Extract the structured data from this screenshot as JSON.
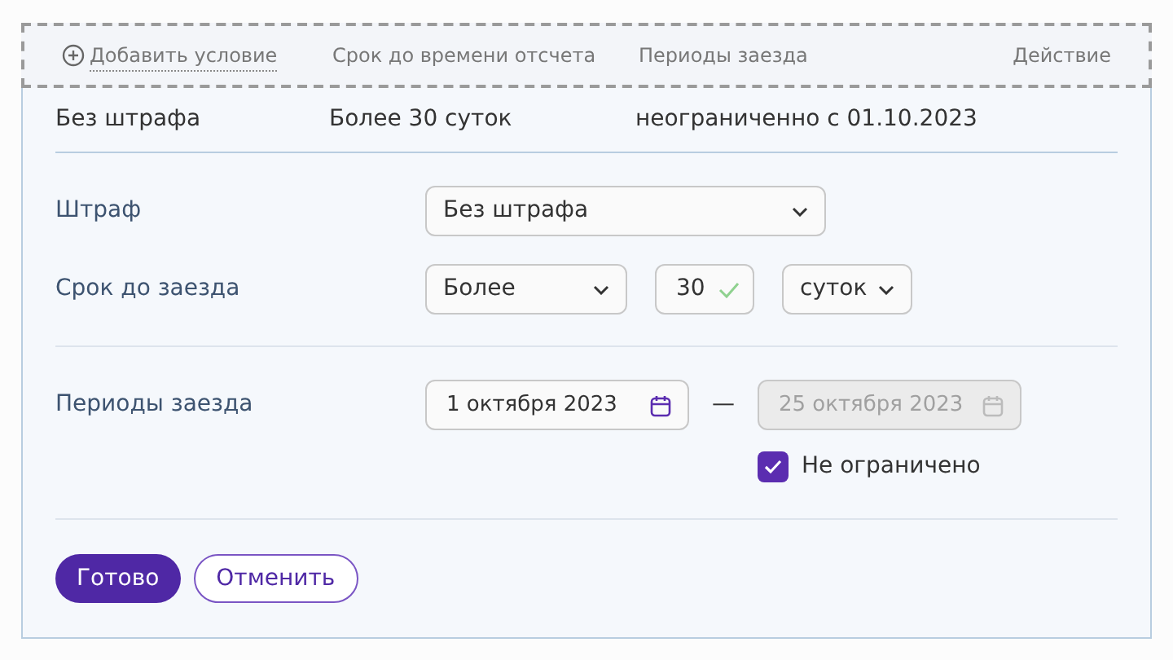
{
  "header": {
    "add_condition": "Добавить условие",
    "columns": [
      "Срок до времени отсчета",
      "Периоды заезда"
    ],
    "action": "Действие"
  },
  "summary_row": [
    "Без штрафа",
    "Более 30 суток",
    "неограниченно с 01.10.2023"
  ],
  "penalty": {
    "label": "Штраф",
    "value": "Без штрафа"
  },
  "term": {
    "label": "Срок до заезда",
    "comparison": "Более",
    "amount": "30",
    "amount_valid": true,
    "unit": "суток"
  },
  "periods": {
    "label": "Периоды заезда",
    "from": {
      "value": "1 октября 2023",
      "disabled": false
    },
    "separator": "—",
    "to": {
      "value": "25 октября 2023",
      "disabled": true
    },
    "unlimited": {
      "label": "Не ограничено",
      "checked": true
    }
  },
  "buttons": {
    "done": "Готово",
    "cancel": "Отменить"
  }
}
